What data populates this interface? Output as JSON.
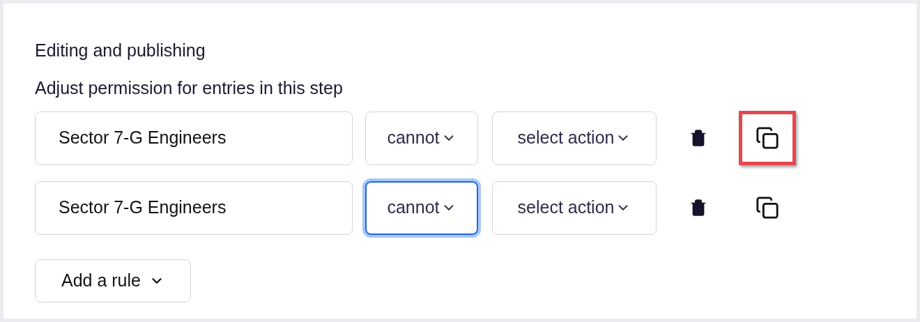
{
  "section": {
    "title": "Editing and publishing",
    "description": "Adjust permission for entries in this step"
  },
  "rules": [
    {
      "group": "Sector 7-G Engineers",
      "mode": {
        "value": "cannot",
        "focused": false
      },
      "action": {
        "value": "select action"
      },
      "copy_highlighted": true
    },
    {
      "group": "Sector 7-G Engineers",
      "mode": {
        "value": "cannot",
        "focused": true
      },
      "action": {
        "value": "select action"
      },
      "copy_highlighted": false
    }
  ],
  "add_rule_button": "Add a rule"
}
